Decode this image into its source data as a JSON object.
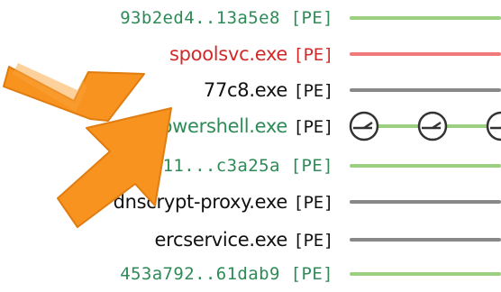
{
  "rows": [
    {
      "label": "93b2ed4..13a5e8",
      "tag": "[PE]",
      "label_color": "#2e8b57",
      "line_color": "#9ccf80"
    },
    {
      "label": "spoolsvc.exe",
      "tag": "[PE]",
      "label_color": "#d12a2a",
      "line_color": "#f07a7a"
    },
    {
      "label": "77c8.exe",
      "tag": "[PE]",
      "label_color": "#111111",
      "line_color": "#888888"
    },
    {
      "label": "powershell.exe",
      "tag": "[PE]",
      "label_color": "#2e8b57",
      "line_color": "#9ccf80"
    },
    {
      "label": "11...c3a25a",
      "tag": "[PE]",
      "label_color": "#2e8b57",
      "line_color": "#9ccf80"
    },
    {
      "label": "dnscrypt-proxy.exe",
      "tag": "[PE]",
      "label_color": "#111111",
      "line_color": "#888888"
    },
    {
      "label": "ercservice.exe",
      "tag": "[PE]",
      "label_color": "#111111",
      "line_color": "#888888"
    },
    {
      "label": "453a792..61dab9",
      "tag": "[PE]",
      "label_color": "#2e8b57",
      "line_color": "#9ccf80"
    }
  ],
  "icons": {
    "timer": "clock-icon",
    "pointer": "arrow-icon"
  },
  "colors": {
    "arrow": "#f7931e",
    "background": "#ffffff"
  }
}
